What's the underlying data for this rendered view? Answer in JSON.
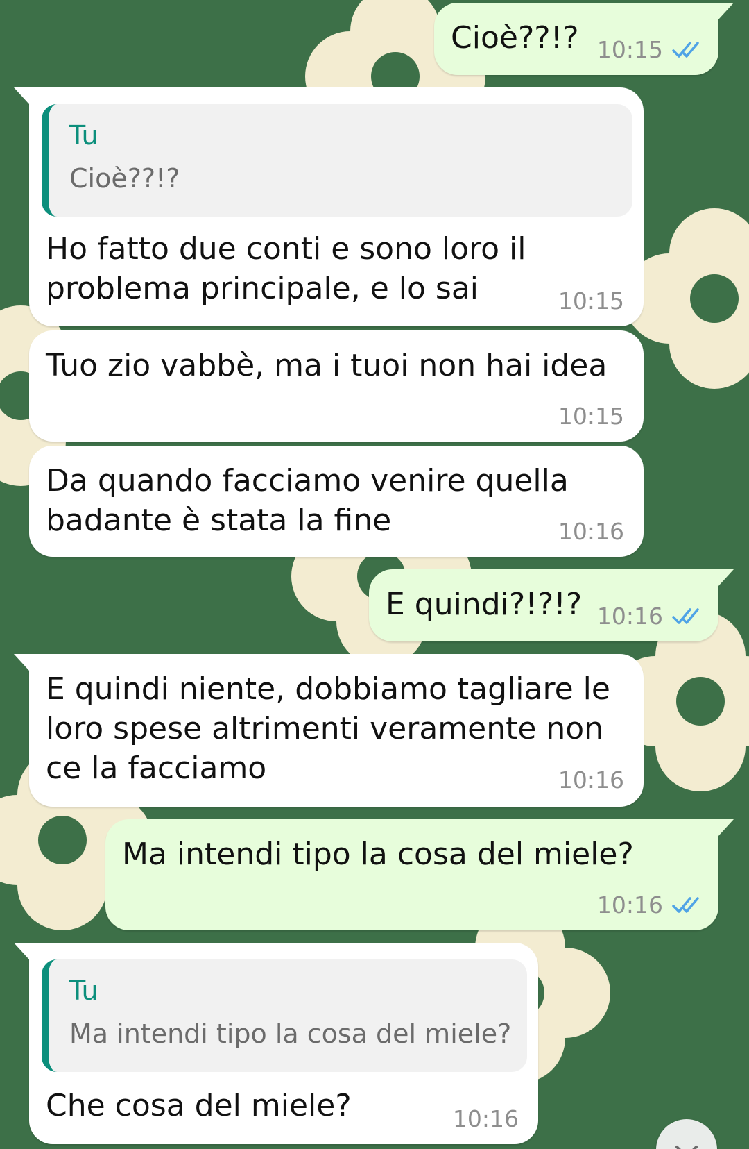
{
  "colors": {
    "wallpaper": "#3d7048",
    "incoming_bubble": "#ffffff",
    "outgoing_bubble": "#e7fddb",
    "quote_accent": "#0c8f7c",
    "read_ticks": "#4fa3e6"
  },
  "messages": [
    {
      "direction": "outgoing",
      "text": "Cioè??!?",
      "time": "10:15",
      "status_icon": "double-check-read-icon"
    },
    {
      "direction": "incoming",
      "quote_author": "Tu",
      "quote_text": "Cioè??!?",
      "text": "Ho fatto due conti e sono loro il\nproblema principale, e lo sai",
      "time": "10:15"
    },
    {
      "direction": "incoming",
      "text": "Tuo zio vabbè, ma i tuoi non hai idea",
      "time": "10:15"
    },
    {
      "direction": "incoming",
      "text": "Da quando facciamo venire quella\nbadante è stata la fine",
      "time": "10:16"
    },
    {
      "direction": "outgoing",
      "text": "E quindi?!?!?",
      "time": "10:16",
      "status_icon": "double-check-read-icon"
    },
    {
      "direction": "incoming",
      "text": "E quindi niente, dobbiamo tagliare le\nloro spese altrimenti veramente non\nce la facciamo",
      "time": "10:16"
    },
    {
      "direction": "outgoing",
      "text": "Ma intendi tipo la cosa del miele?",
      "time": "10:16",
      "status_icon": "double-check-read-icon"
    },
    {
      "direction": "incoming",
      "quote_author": "Tu",
      "quote_text": "Ma intendi tipo la cosa del miele?",
      "text": "Che cosa del miele?",
      "time": "10:16"
    }
  ],
  "scroll_button": {
    "icon": "chevron-down-icon"
  }
}
